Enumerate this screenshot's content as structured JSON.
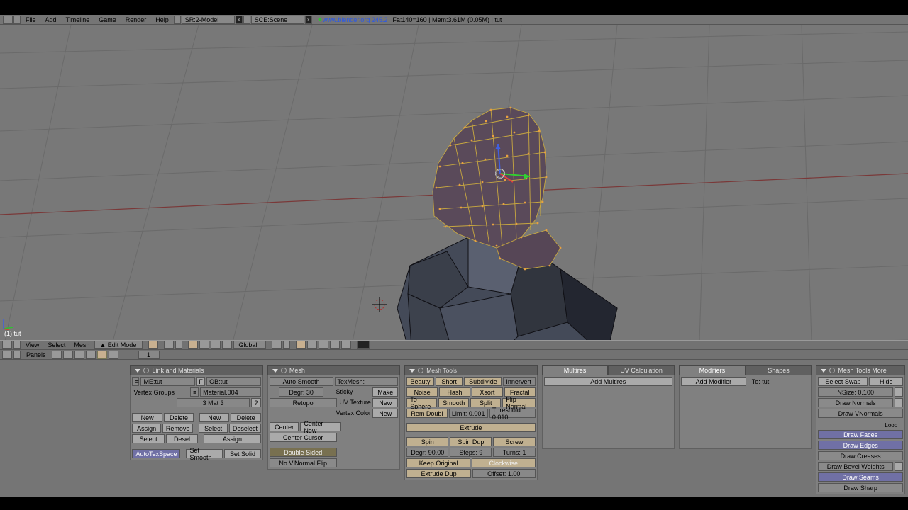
{
  "top_menu": {
    "file": "File",
    "add": "Add",
    "timeline": "Timeline",
    "game": "Game",
    "render": "Render",
    "help": "Help",
    "screen": "SR:2-Model",
    "scene": "SCE:Scene",
    "link": "www.blender.org 245.2",
    "stats": "Fa:140=160 | Mem:3.61M (0.05M) | tut"
  },
  "viewport": {
    "label": "(1) tut"
  },
  "view_header": {
    "view": "View",
    "select": "Select",
    "mesh": "Mesh",
    "mode": "▲ Edit Mode",
    "orient": "Global"
  },
  "panels_header": {
    "label": "Panels",
    "frame": "1"
  },
  "link_materials": {
    "title": "Link and Materials",
    "me": "ME:tut",
    "f": "F",
    "ob": "OB:tut",
    "vertex_groups": "Vertex Groups",
    "material": "Material.004",
    "mat_index": "3 Mat 3",
    "qmark": "?",
    "new": "New",
    "delete": "Delete",
    "assign": "Assign",
    "remove": "Remove",
    "select": "Select",
    "desel": "Desel",
    "deselect": "Deselect",
    "autotex": "AutoTexSpace",
    "setsmooth": "Set Smooth",
    "setsolid": "Set Solid"
  },
  "mesh_panel": {
    "title": "Mesh",
    "auto_smooth": "Auto Smooth",
    "degr": "Degr: 30",
    "retopo": "Retopo",
    "center": "Center",
    "center_new": "Center New",
    "center_cursor": "Center Cursor",
    "double_sided": "Double Sided",
    "no_v_normal": "No V.Normal Flip",
    "texmesh": "TexMesh:",
    "sticky": "Sticky",
    "make": "Make",
    "uv_texture": "UV Texture",
    "new": "New",
    "vertex_color": "Vertex Color"
  },
  "mesh_tools": {
    "title": "Mesh Tools",
    "beauty": "Beauty",
    "short": "Short",
    "subdivide": "Subdivide",
    "innervert": "Innervert",
    "noise": "Noise",
    "hash": "Hash",
    "xsort": "Xsort",
    "fractal": "Fractal",
    "to_sphere": "To Sphere",
    "smooth": "Smooth",
    "split": "Split",
    "flip_normal": "Flip Normal",
    "rem_doubl": "Rem Doubl",
    "limit": "Limit: 0.001",
    "threshold": "Threshold: 0.010",
    "extrude": "Extrude",
    "spin": "Spin",
    "spin_dup": "Spin Dup",
    "screw": "Screw",
    "degr": "Degr: 90.00",
    "steps": "Steps: 9",
    "turns": "Turns: 1",
    "keep_original": "Keep Original",
    "clockwise": "Clockwise",
    "extrude_dup": "Extrude Dup",
    "offset": "Offset: 1.00"
  },
  "multires": {
    "title": "Multires",
    "uv_calc": "UV Calculation",
    "add_multires": "Add Multires"
  },
  "modifiers": {
    "title": "Modifiers",
    "shapes": "Shapes",
    "add_modifier": "Add Modifier",
    "to": "To: tut"
  },
  "mesh_tools_more": {
    "title": "Mesh Tools More",
    "select_swap": "Select Swap",
    "hide": "Hide",
    "nsize": "NSize: 0.100",
    "draw_normals": "Draw Normals",
    "draw_vnormals": "Draw VNormals",
    "loop": "Loop",
    "draw_faces": "Draw Faces",
    "draw_edges": "Draw Edges",
    "draw_creases": "Draw Creases",
    "draw_bevel": "Draw Bevel Weights",
    "draw_seams": "Draw Seams",
    "draw_sharp": "Draw Sharp"
  }
}
